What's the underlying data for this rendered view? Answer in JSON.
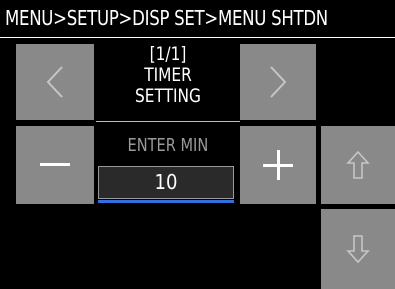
{
  "header": {
    "breadcrumb": "MENU>SETUP>DISP SET>MENU SHTDN"
  },
  "title": {
    "page": "[1/1]",
    "line1": "TIMER",
    "line2": "SETTING"
  },
  "input": {
    "label": "ENTER MIN",
    "value": "10"
  },
  "buttons": {
    "prev": "chevron-left-icon",
    "next": "chevron-right-icon",
    "decrease": "minus-icon",
    "increase": "plus-icon",
    "up": "arrow-up-icon",
    "down": "arrow-down-icon"
  },
  "colors": {
    "button_bg": "#898989",
    "accent_underline": "#2f6fe0",
    "background": "#000000"
  }
}
